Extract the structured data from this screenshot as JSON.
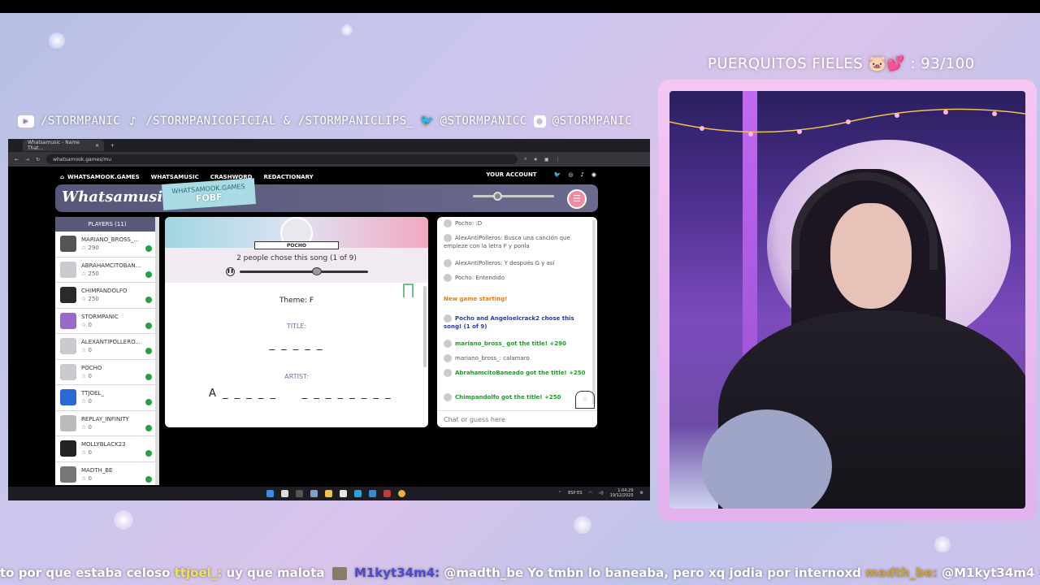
{
  "overlay": {
    "goal_text": "PUERQUITOS FIELES 🐷💕 : 93/100",
    "socials": {
      "youtube": "/STORMPANIC",
      "tiktok": "/STORMPANICOFICIAL & /STORMPANICLIPS_",
      "twitter": "@STORMPANICC",
      "instagram": "@STORMPANIC"
    },
    "ticker": {
      "msg1_text": "to por que estaba celoso",
      "user1": "ttjoel_:",
      "msg2_text": "uy que malota",
      "user2": "M1kyt34m4:",
      "msg3_text": "@madth_be Yo tmbn lo baneaba, pero xq jodia por internoxd",
      "user3": "madth_be:",
      "msg4_text": "@M1kyt34m4 XD"
    }
  },
  "browser": {
    "tab_title": "Whatsamusic - Name That...",
    "url": "whatsamook.games/mu"
  },
  "site": {
    "nav": [
      "WHATSAMOOK.GAMES",
      "WHATSAMUSIC",
      "CRASHWORD",
      "REDACTIONARY"
    ],
    "account": "YOUR ACCOUNT",
    "logo": "Whatsamusic",
    "room_label": "WHATSAMOOK.GAMES",
    "room_code": "FOBF",
    "volume": 0.3,
    "players_header": "PLAYERS (11)",
    "players": [
      {
        "name": "MARIANO_BROSS_...",
        "score": "☆ 290"
      },
      {
        "name": "ABRAHAMCITOBAN...",
        "score": "☆ 250"
      },
      {
        "name": "CHIMPANDOLFO",
        "score": "☆ 250"
      },
      {
        "name": "STORMPANIC",
        "score": "☆ 0"
      },
      {
        "name": "ALEXANTIPOLLERO...",
        "score": "☆ 0"
      },
      {
        "name": "POCHO",
        "score": "☆ 0"
      },
      {
        "name": "TTJOEL_",
        "score": "☆ 0"
      },
      {
        "name": "REPLAY_INFINITY",
        "score": "☆ 0"
      },
      {
        "name": "MOLLYBLACK23",
        "score": "☆ 0"
      },
      {
        "name": "MADTH_BE",
        "score": "☆ 0"
      }
    ],
    "drawer": "POCHO",
    "chose_text": "2 people chose this song (1 of 9)",
    "progress": 0.6,
    "theme": "Theme: F",
    "title_label": "TITLE:",
    "title_blanks": "_ _ _ _ _",
    "artist_label": "ARTIST:",
    "artist_blanks": "A _ _ _ _ _     _ _ _ _ _ _ _ _",
    "chat": [
      {
        "text": "Pocho: :D",
        "style": "plain",
        "avatar": true
      },
      {
        "text": "AlexAntiPolleros: Busca una canción que empieze con la letra F y ponla",
        "style": "plain",
        "avatar": true
      },
      {
        "text": "AlexAntiPolleros: Y después G y así",
        "style": "plain",
        "avatar": true
      },
      {
        "text": "Pocho: Entendido",
        "style": "plain",
        "avatar": true
      },
      {
        "text": "New game starting!",
        "style": "orange",
        "avatar": false
      },
      {
        "text": "Pocho and Angeloelcrack2 chose this song! (1 of 9)",
        "style": "blue",
        "avatar": true
      },
      {
        "text": "mariano_bross_ got the title! +290",
        "style": "green",
        "avatar": true
      },
      {
        "text": "mariano_bross_: calamaro",
        "style": "plain",
        "avatar": true
      },
      {
        "text": "AbrahamcitoBaneado got the title! +250",
        "style": "green",
        "avatar": true
      },
      {
        "text": "Chimpandolfo got the title! +250",
        "style": "green",
        "avatar": true
      }
    ],
    "chat_placeholder": "Chat or guess here"
  },
  "taskbar": {
    "lang": "ESP\nES",
    "time": "1:04:29",
    "date": "19/12/2025"
  },
  "colors": {
    "accent_pink": "#f08aa0",
    "nav_bg": "#5a5a78",
    "ok_green": "#27a046"
  }
}
